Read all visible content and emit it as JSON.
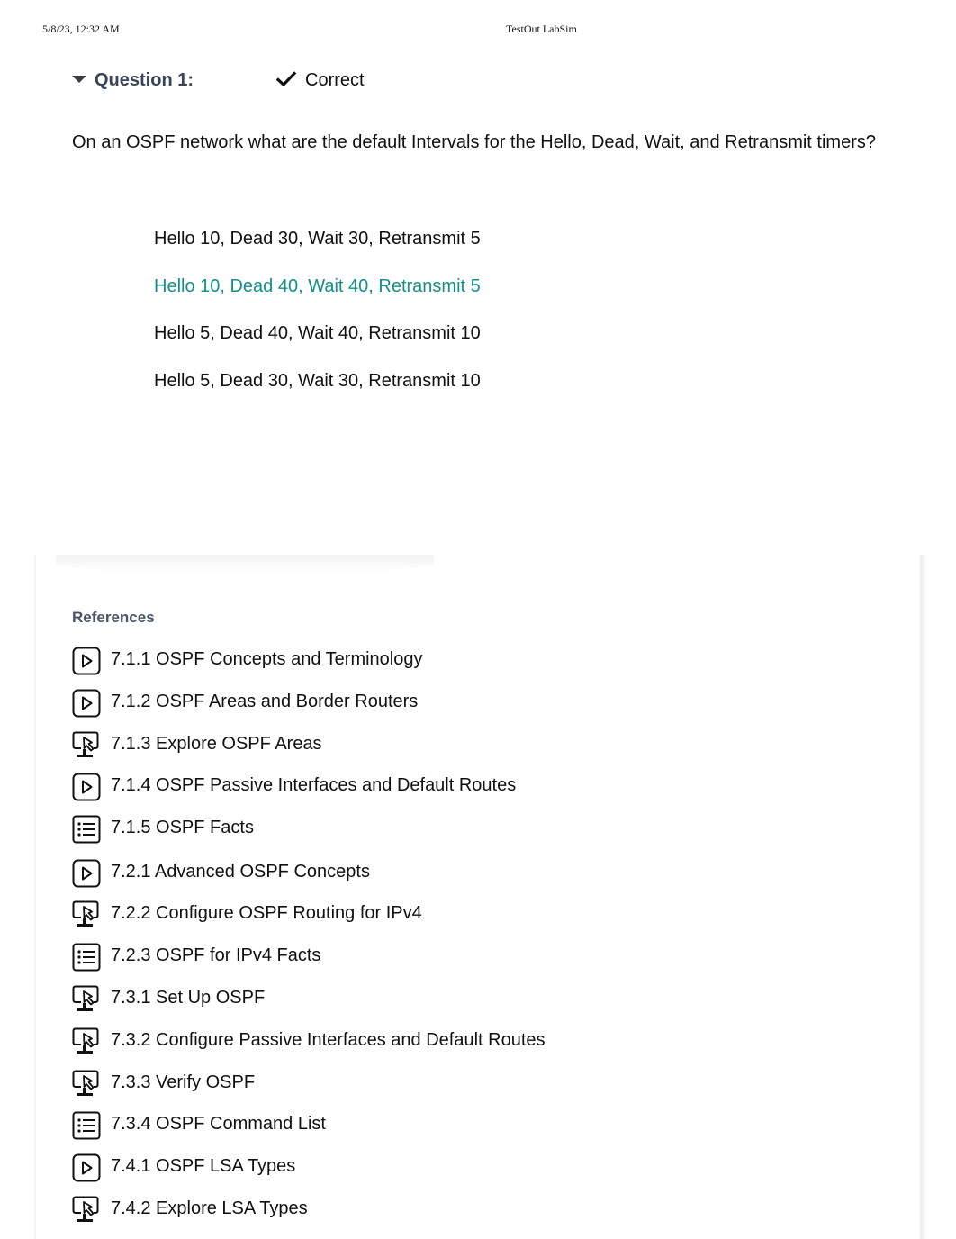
{
  "print_header": {
    "date": "5/8/23, 12:32 AM",
    "title": "TestOut LabSim"
  },
  "question": {
    "label": "Question 1:",
    "status": "Correct",
    "status_icon": "checkmark-icon",
    "text": "On an OSPF network what are the default Intervals for the Hello, Dead, Wait, and Retransmit timers?",
    "answers": [
      {
        "text": "Hello 10, Dead 30, Wait 30, Retransmit 5",
        "correct": false
      },
      {
        "text": "Hello 10, Dead 40, Wait 40, Retransmit 5",
        "correct": true
      },
      {
        "text": "Hello 5, Dead 40, Wait 40, Retransmit 10",
        "correct": false
      },
      {
        "text": "Hello 5, Dead 30, Wait 30, Retransmit 10",
        "correct": false
      }
    ]
  },
  "colors": {
    "correct_answer": "#12918a",
    "question_label": "#3a4458",
    "references_title": "#4a5568"
  },
  "references": {
    "title": "References",
    "items": [
      {
        "icon": "video-icon",
        "label": "7.1.1 OSPF Concepts and Terminology"
      },
      {
        "icon": "video-icon",
        "label": "7.1.2 OSPF Areas and Border Routers"
      },
      {
        "icon": "demo-icon",
        "label": "7.1.3 Explore OSPF Areas"
      },
      {
        "icon": "video-icon",
        "label": "7.1.4 OSPF Passive Interfaces and Default Routes"
      },
      {
        "icon": "list-icon",
        "label": "7.1.5 OSPF Facts"
      },
      {
        "icon": "video-icon",
        "label": "7.2.1 Advanced OSPF Concepts"
      },
      {
        "icon": "demo-icon",
        "label": "7.2.2 Configure OSPF Routing for IPv4"
      },
      {
        "icon": "list-icon",
        "label": "7.2.3 OSPF for IPv4 Facts"
      },
      {
        "icon": "demo-icon",
        "label": "7.3.1 Set Up OSPF"
      },
      {
        "icon": "demo-icon",
        "label": "7.3.2 Configure Passive Interfaces and Default Routes"
      },
      {
        "icon": "demo-icon",
        "label": "7.3.3 Verify OSPF"
      },
      {
        "icon": "list-icon",
        "label": "7.3.4 OSPF Command List"
      },
      {
        "icon": "video-icon",
        "label": "7.4.1 OSPF LSA Types"
      },
      {
        "icon": "demo-icon",
        "label": "7.4.2 Explore LSA Types"
      }
    ]
  }
}
